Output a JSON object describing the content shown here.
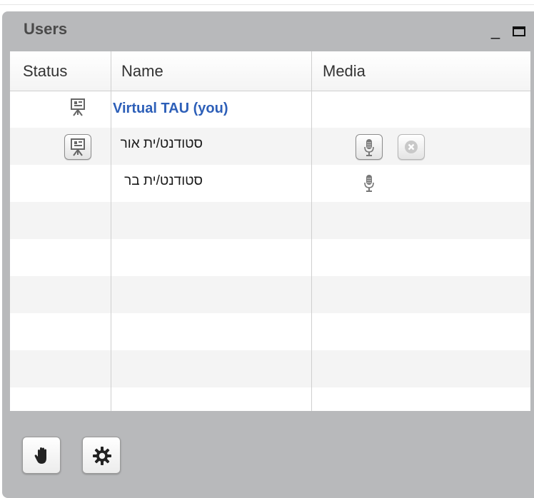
{
  "panel": {
    "title": "Users"
  },
  "columns": {
    "status": "Status",
    "name": "Name",
    "media": "Media"
  },
  "users": [
    {
      "name": "Virtual TAU (you)",
      "status_icon": "presenter-icon",
      "is_you": true
    },
    {
      "name": "סטודנט/ית אור",
      "status_icon": "presenter-icon",
      "media_icons": [
        "microphone-icon",
        "remove-icon"
      ]
    },
    {
      "name": "סטודנט/ית בר",
      "media_icons": [
        "microphone-icon"
      ]
    }
  ],
  "footer": {
    "buttons": [
      "raise-hand-icon",
      "settings-gear-icon"
    ]
  },
  "colors": {
    "window": "#b8b9bb",
    "you_name": "#2d5fb8",
    "grid_lines": "#cfcfcf",
    "row_alt": "#f4f4f4"
  }
}
